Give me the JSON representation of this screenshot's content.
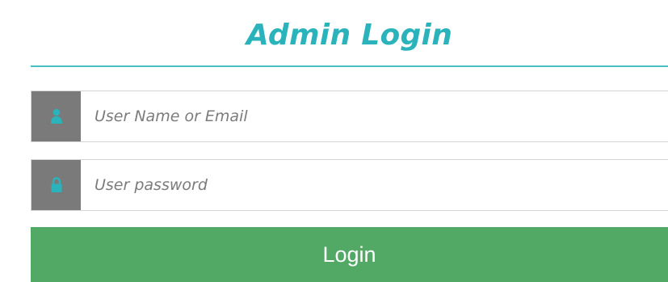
{
  "header": {
    "title": "Admin Login"
  },
  "form": {
    "username": {
      "placeholder": "User Name or Email",
      "value": "",
      "icon": "user-icon"
    },
    "password": {
      "placeholder": "User password",
      "value": "",
      "icon": "lock-icon"
    },
    "submit_label": "Login"
  },
  "colors": {
    "accent": "#2ab3bb",
    "icon_bg": "#7a7a7a",
    "button_bg": "#52a965",
    "button_text": "#ffffff"
  }
}
